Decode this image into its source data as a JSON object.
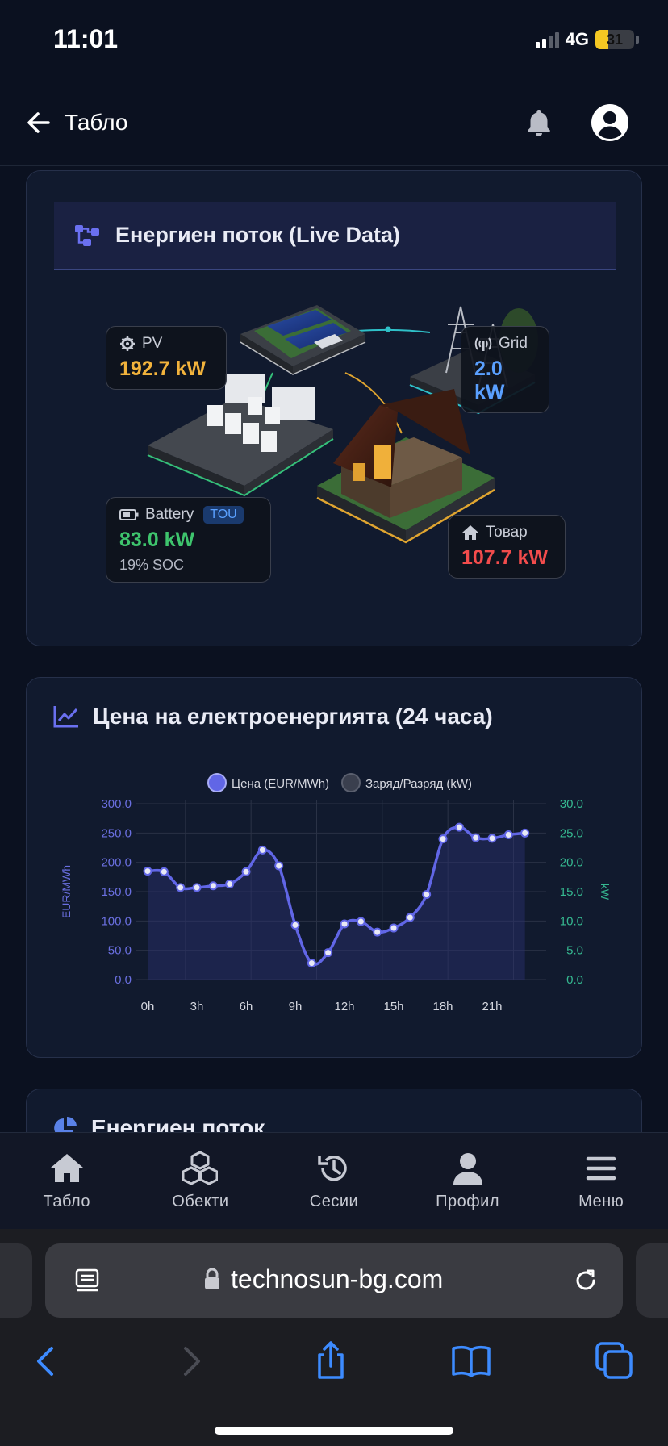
{
  "status": {
    "time": "11:01",
    "network": "4G",
    "battery": "31"
  },
  "header": {
    "title": "Табло"
  },
  "energy_flow": {
    "title": "Енергиен поток (Live Data)",
    "pv": {
      "label": "PV",
      "value": "192.7 kW",
      "color": "#f2b33c"
    },
    "grid": {
      "label": "Grid",
      "value": "2.0 kW",
      "color": "#5aa0ff"
    },
    "battery": {
      "label": "Battery",
      "badge": "TOU",
      "value": "83.0 kW",
      "soc": "19% SOC",
      "color": "#3ec46d"
    },
    "load": {
      "label": "Товар",
      "value": "107.7 kW",
      "color": "#f24c4c"
    }
  },
  "price_card": {
    "title": "Цена на електроенергията (24 часа)",
    "icon": "line-chart-icon"
  },
  "chart_data": {
    "type": "line",
    "title": "Цена на електроенергията (24 часа)",
    "legend": [
      "Цена (EUR/MWh)",
      "Заряд/Разряд (kW)"
    ],
    "legend_position": "top",
    "x_ticks": [
      "0h",
      "3h",
      "6h",
      "9h",
      "12h",
      "15h",
      "18h",
      "21h"
    ],
    "ylabel_left": "EUR/MWh",
    "ylabel_right": "kW",
    "yticks_left": [
      "0.0",
      "50.0",
      "100.0",
      "150.0",
      "200.0",
      "250.0",
      "300.0"
    ],
    "yticks_right": [
      "0.0",
      "5.0",
      "10.0",
      "15.0",
      "20.0",
      "25.0",
      "30.0"
    ],
    "ylim_left": [
      0,
      300
    ],
    "ylim_right": [
      0,
      30
    ],
    "grid": true,
    "series": [
      {
        "name": "Цена (EUR/MWh)",
        "color": "#6166e6",
        "x": [
          0,
          1,
          2,
          3,
          4,
          5,
          6,
          7,
          8,
          9,
          10,
          11,
          12,
          13,
          14,
          15,
          16,
          17,
          18,
          19,
          20,
          21,
          22,
          23
        ],
        "values": [
          185,
          184,
          157,
          157,
          160,
          163,
          184,
          221,
          194,
          93,
          28,
          46,
          95,
          99,
          81,
          88,
          106,
          145,
          240,
          260,
          242,
          241,
          247,
          250
        ]
      }
    ]
  },
  "next_card": {
    "title": "Енергиен поток"
  },
  "tabs": [
    {
      "label": "Табло",
      "icon": "home-icon"
    },
    {
      "label": "Обекти",
      "icon": "cubes-icon"
    },
    {
      "label": "Сесии",
      "icon": "history-icon"
    },
    {
      "label": "Профил",
      "icon": "person-icon"
    },
    {
      "label": "Меню",
      "icon": "menu-icon"
    }
  ],
  "browser": {
    "url": "technosun-bg.com"
  }
}
